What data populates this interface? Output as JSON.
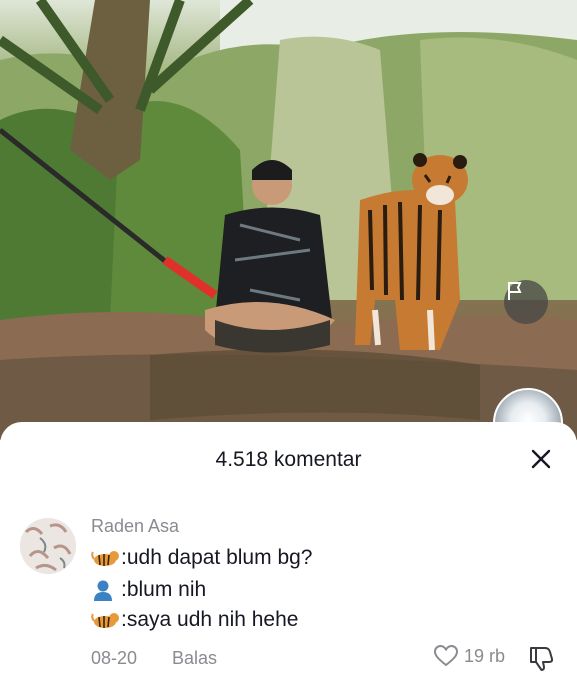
{
  "video": {
    "report_icon": "flag-icon"
  },
  "comments_sheet": {
    "title": "4.518 komentar",
    "close_icon": "close-icon"
  },
  "comment": {
    "username": "Raden Asa",
    "lines": [
      {
        "icon": "tiger-emoji",
        "text": ":udh dapat blum bg?"
      },
      {
        "icon": "person-emoji",
        "text": ":blum nih"
      },
      {
        "icon": "tiger-emoji",
        "text": ":saya udh nih hehe"
      }
    ],
    "date": "08-20",
    "reply_label": "Balas",
    "like_count": "19 rb",
    "like_icon": "heart-icon",
    "dislike_icon": "thumbs-down-icon"
  }
}
